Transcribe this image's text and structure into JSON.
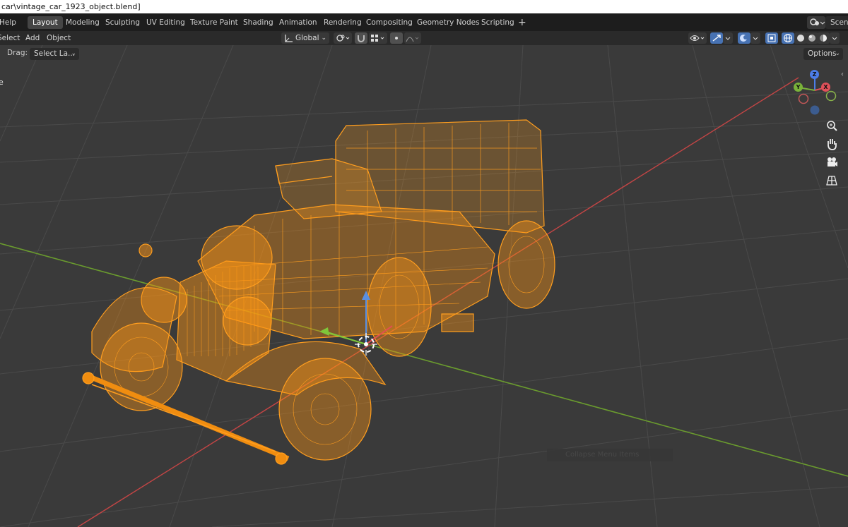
{
  "window": {
    "title": "car\\vintage_car_1923_object.blend]"
  },
  "topbar": {
    "help_label": "Help",
    "workspaces": [
      {
        "label": "Layout",
        "active": true
      },
      {
        "label": "Modeling",
        "active": false
      },
      {
        "label": "Sculpting",
        "active": false
      },
      {
        "label": "UV Editing",
        "active": false
      },
      {
        "label": "Texture Paint",
        "active": false
      },
      {
        "label": "Shading",
        "active": false
      },
      {
        "label": "Animation",
        "active": false
      },
      {
        "label": "Rendering",
        "active": false
      },
      {
        "label": "Compositing",
        "active": false
      },
      {
        "label": "Geometry Nodes",
        "active": false
      },
      {
        "label": "Scripting",
        "active": false
      }
    ],
    "add_tab_icon": "plus-icon",
    "scene_label": "Scene"
  },
  "viewport_header": {
    "menus": [
      "Select",
      "Add",
      "Object"
    ],
    "transform_orientation": "Global",
    "options_label": "Options"
  },
  "tool_settings": {
    "drag_label": "Drag:",
    "drag_value": "Select La..."
  },
  "viewport": {
    "object_label_partial": "e",
    "tooltip": "Collapse Menu Items",
    "wire_color": "#ff9e1f",
    "x_axis_color": "#c34545",
    "y_axis_color": "#6a9b2e",
    "grid_color": "#4a4a4a",
    "nav_icons": [
      "zoom-icon",
      "hand-pan-icon",
      "camera-icon",
      "grid-perspective-icon"
    ],
    "gizmo": {
      "z": "Z",
      "y": "Y",
      "x": "X"
    }
  }
}
